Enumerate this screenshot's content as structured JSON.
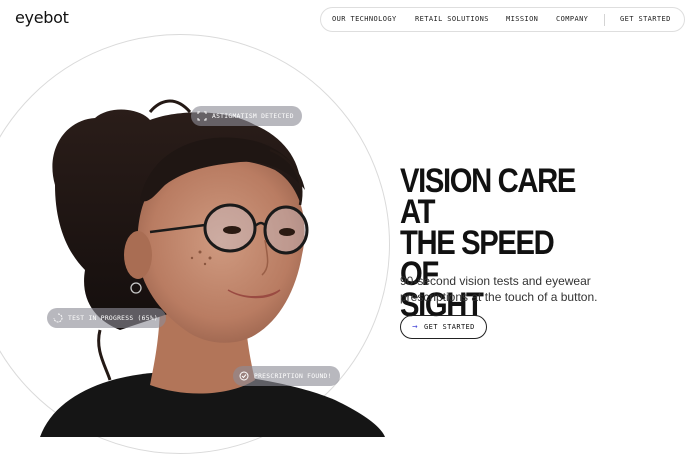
{
  "brand": {
    "logo": "eyebot"
  },
  "nav": {
    "items": [
      "OUR TECHNOLOGY",
      "RETAIL SOLUTIONS",
      "MISSION",
      "COMPANY"
    ],
    "cta": "GET STARTED"
  },
  "hero": {
    "headline_lines": [
      "VISION CARE AT",
      "THE SPEED OF",
      "SIGHT"
    ],
    "subtitle": "90-second vision tests and eyewear prescriptions at the touch of a button.",
    "cta_label": "GET STARTED",
    "cta_icon": "arrow-right-icon"
  },
  "badges": [
    {
      "label": "ASTIGMATISM DETECTED",
      "icon": "scan-icon"
    },
    {
      "label": "TEST IN PROGRESS (65%)",
      "icon": "spinner-icon"
    },
    {
      "label": "PRESCRIPTION FOUND!",
      "icon": "check-circle-icon"
    }
  ],
  "colors": {
    "accent": "#4a4ad8",
    "text": "#111111",
    "badge_bg": "#8c8c96"
  }
}
